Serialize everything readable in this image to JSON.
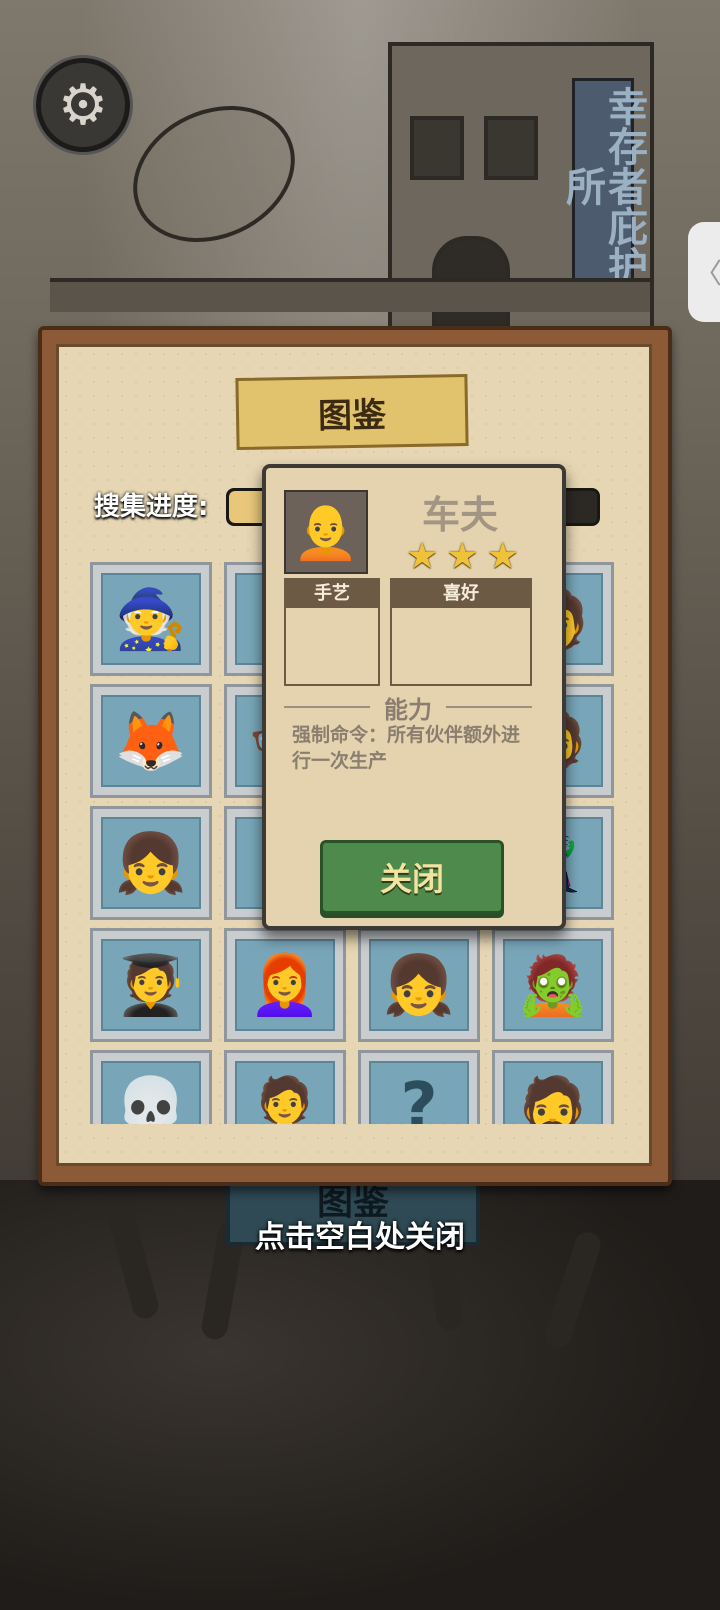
{
  "background": {
    "shelter_sign": "幸存者庇护所"
  },
  "settings": {
    "icon": "gear-icon"
  },
  "side_tab": {
    "icon": "chevron-left-icon"
  },
  "collection": {
    "title": "图鉴",
    "progress_label": "搜集进度:",
    "progress_fraction": 0.22,
    "cards": [
      {
        "emoji": "🧙",
        "locked": false
      },
      {
        "emoji": "🐧",
        "locked": false
      },
      {
        "emoji": "",
        "locked": false
      },
      {
        "emoji": "🧑",
        "locked": false
      },
      {
        "emoji": "🦊",
        "locked": false
      },
      {
        "emoji": "👓",
        "locked": false
      },
      {
        "emoji": "",
        "locked": false
      },
      {
        "emoji": "🧔",
        "locked": false
      },
      {
        "emoji": "👧",
        "locked": false
      },
      {
        "emoji": "⚡",
        "locked": false
      },
      {
        "emoji": "",
        "locked": false
      },
      {
        "emoji": "🦹",
        "locked": false
      },
      {
        "emoji": "🧑‍🎓",
        "locked": false
      },
      {
        "emoji": "👩‍🦰",
        "locked": false
      },
      {
        "emoji": "👧",
        "locked": false
      },
      {
        "emoji": "🧟",
        "locked": false
      },
      {
        "emoji": "💀",
        "locked": false
      },
      {
        "emoji": "🧑‍💼",
        "locked": false
      },
      {
        "emoji": "?",
        "locked": true
      },
      {
        "emoji": "🧔",
        "locked": false
      }
    ]
  },
  "detail": {
    "name": "车夫",
    "stars": 3,
    "craft_label": "手艺",
    "hobby_label": "喜好",
    "ability_label": "能力",
    "ability_text": "强制命令：所有伙伴额外进行一次生产",
    "close_label": "关闭",
    "portrait": "🧑‍🦲"
  },
  "bottom_tab_label": "图鉴",
  "hint": "点击空白处关闭",
  "colors": {
    "close_button": "#4d8a4b",
    "star": "#f0c23a",
    "progress_fill": "#e8c77a"
  }
}
